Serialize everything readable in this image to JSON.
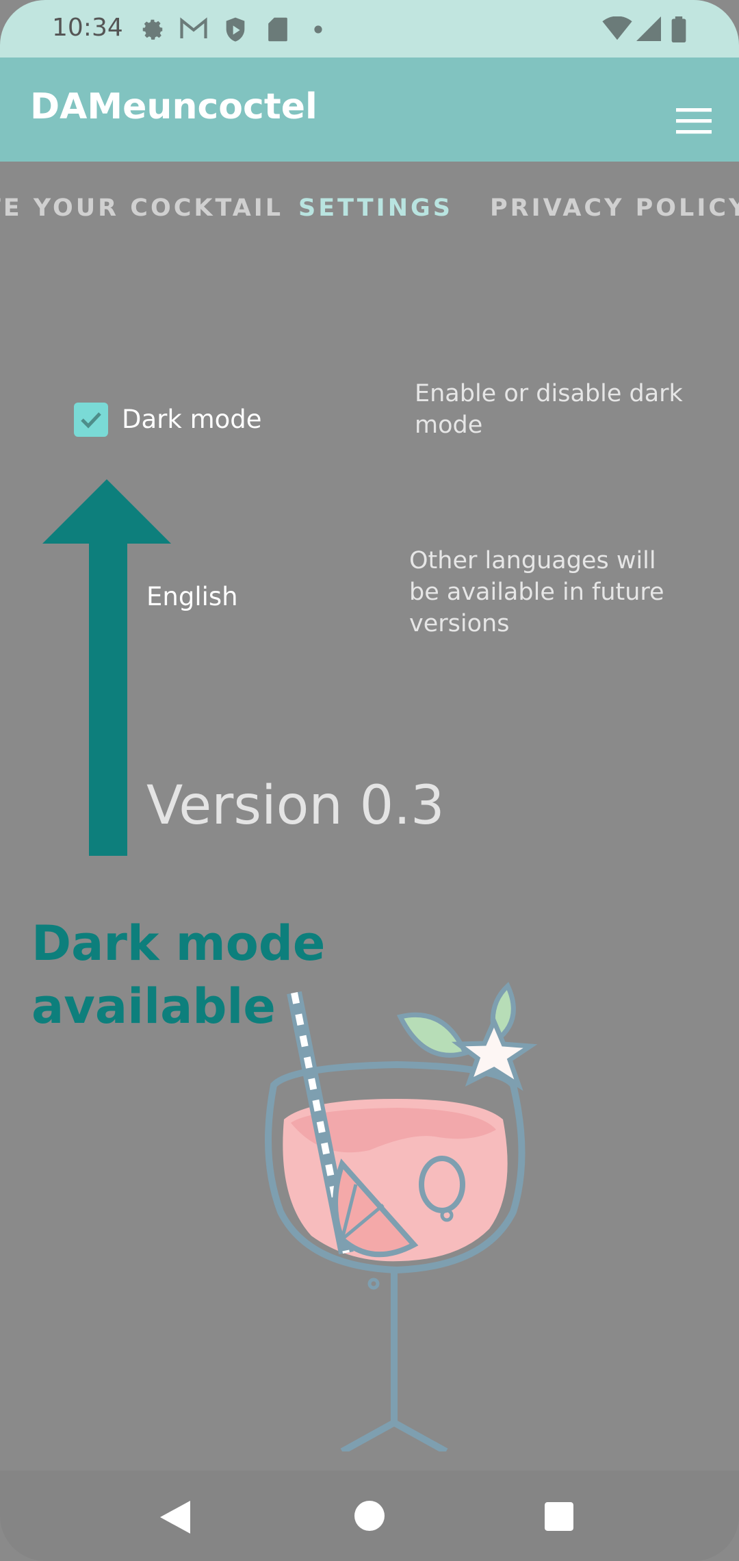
{
  "status_bar": {
    "time": "10:34",
    "icons": [
      "gear-icon",
      "gmail-icon",
      "shield-play-icon",
      "sd-card-icon",
      "dot-icon",
      "wifi-icon",
      "signal-icon",
      "battery-icon"
    ]
  },
  "app_bar": {
    "title": "DAMeuncoctel",
    "menu_icon": "hamburger-menu-icon"
  },
  "tabs": [
    {
      "label": "CREATE YOUR COCKTAIL",
      "active": false
    },
    {
      "label": "SETTINGS",
      "active": true
    },
    {
      "label": "PRIVACY POLICY",
      "active": false
    }
  ],
  "settings": {
    "dark_mode": {
      "label": "Dark mode",
      "checked": true,
      "hint": "Enable or disable dark mode"
    },
    "language": {
      "label": "English",
      "hint": "Other languages will be available in future versions"
    },
    "version": "Version 0.3"
  },
  "annotation": {
    "banner": "Dark mode available"
  },
  "colors": {
    "status_bar": "#c1e5df",
    "app_bar": "#81c3c0",
    "accent": "#0d7f7c",
    "checkbox": "#7adad6",
    "background": "#8a8a8a"
  },
  "nav_bar": {
    "buttons": [
      "back-icon",
      "home-icon",
      "recents-icon"
    ]
  }
}
